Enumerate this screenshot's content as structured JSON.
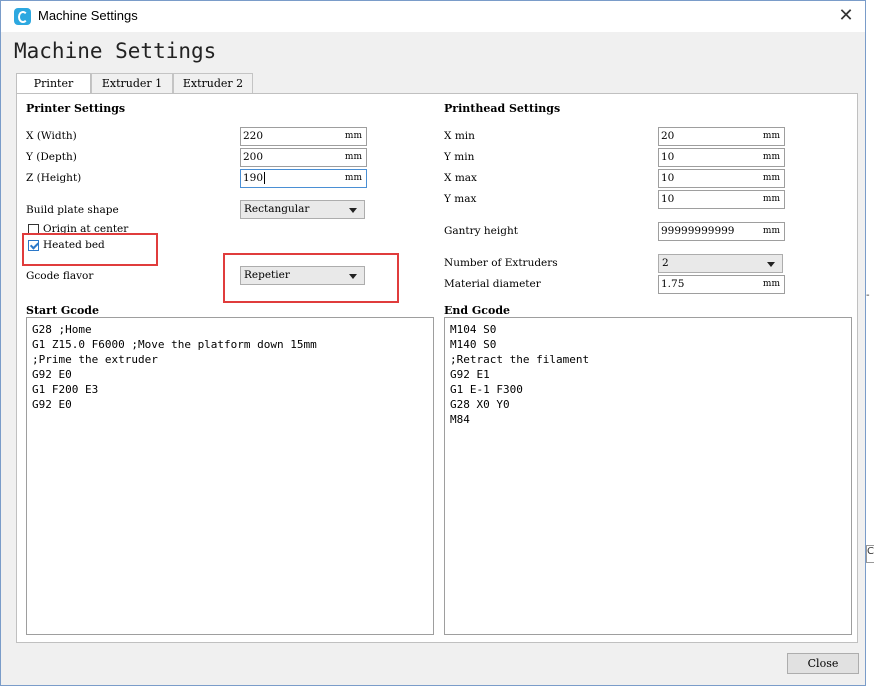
{
  "window": {
    "title": "Machine Settings",
    "close_glyph": "✕"
  },
  "heading": "Machine Settings",
  "tabs": [
    {
      "label": "Printer",
      "active": true
    },
    {
      "label": "Extruder 1",
      "active": false
    },
    {
      "label": "Extruder 2",
      "active": false
    }
  ],
  "printer_settings": {
    "title": "Printer Settings",
    "x_width": {
      "label": "X (Width)",
      "value": "220",
      "unit": "mm"
    },
    "y_depth": {
      "label": "Y (Depth)",
      "value": "200",
      "unit": "mm"
    },
    "z_height": {
      "label": "Z (Height)",
      "value": "190",
      "unit": "mm"
    },
    "build_plate_shape": {
      "label": "Build plate shape",
      "value": "Rectangular"
    },
    "origin_at_center": {
      "label": "Origin at center",
      "checked": false
    },
    "heated_bed": {
      "label": "Heated bed",
      "checked": true
    },
    "gcode_flavor": {
      "label": "Gcode flavor",
      "value": "Repetier"
    }
  },
  "printhead_settings": {
    "title": "Printhead Settings",
    "x_min": {
      "label": "X min",
      "value": "20",
      "unit": "mm"
    },
    "y_min": {
      "label": "Y min",
      "value": "10",
      "unit": "mm"
    },
    "x_max": {
      "label": "X max",
      "value": "10",
      "unit": "mm"
    },
    "y_max": {
      "label": "Y max",
      "value": "10",
      "unit": "mm"
    },
    "gantry_height": {
      "label": "Gantry height",
      "value": "99999999999",
      "unit": "mm"
    },
    "number_of_extruders": {
      "label": "Number of Extruders",
      "value": "2"
    },
    "material_diameter": {
      "label": "Material diameter",
      "value": "1.75",
      "unit": "mm"
    }
  },
  "start_gcode": {
    "title": "Start Gcode",
    "text": "G28 ;Home\nG1 Z15.0 F6000 ;Move the platform down 15mm\n;Prime the extruder\nG92 E0\nG1 F200 E3\nG92 E0"
  },
  "end_gcode": {
    "title": "End Gcode",
    "text": "M104 S0\nM140 S0\n;Retract the filament\nG92 E1\nG1 E-1 F300\nG28 X0 Y0\nM84"
  },
  "buttons": {
    "close": "Close"
  },
  "background_fragment": "Cl",
  "colors": {
    "highlight": "#e03c3c",
    "accent": "#2da8e0"
  }
}
